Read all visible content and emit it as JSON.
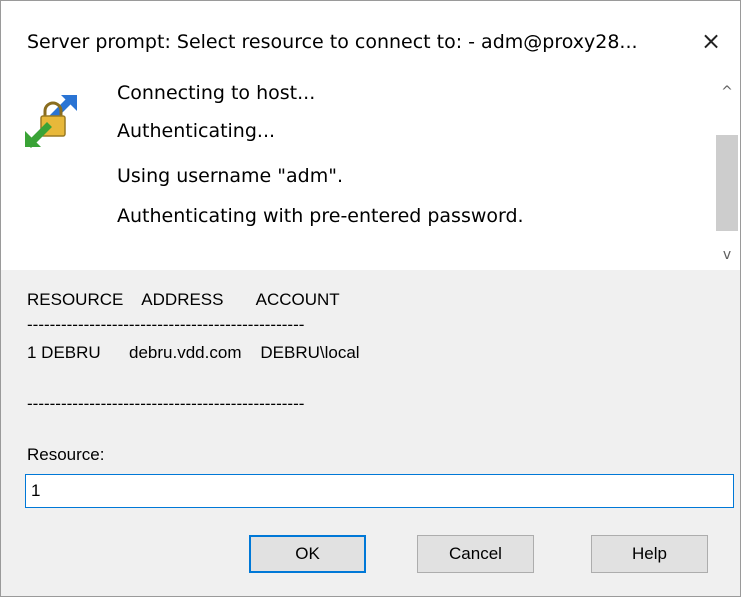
{
  "window": {
    "title": "Server prompt: Select resource to connect to: - adm@proxy28...",
    "close_icon": "×"
  },
  "log": {
    "lines": [
      "Connecting to host...",
      "Authenticating...",
      "Using username \"adm\".",
      "Authenticating with pre-entered password."
    ],
    "scroll_up_icon": "^",
    "scroll_down_icon": "v"
  },
  "prompt": {
    "header": "RESOURCE    ADDRESS       ACCOUNT",
    "separator_top": "-------------------------------------------------",
    "row": "1 DEBRU      debru.vdd.com    DEBRU\\local",
    "separator_bottom": "-------------------------------------------------",
    "resource_label": "Resource:",
    "resource_value": "1"
  },
  "buttons": {
    "ok": "OK",
    "cancel": "Cancel",
    "help": "Help"
  },
  "colors": {
    "accent": "#0078d7",
    "dialog_bg": "#f0f0f0",
    "button_bg": "#e1e1e1"
  }
}
